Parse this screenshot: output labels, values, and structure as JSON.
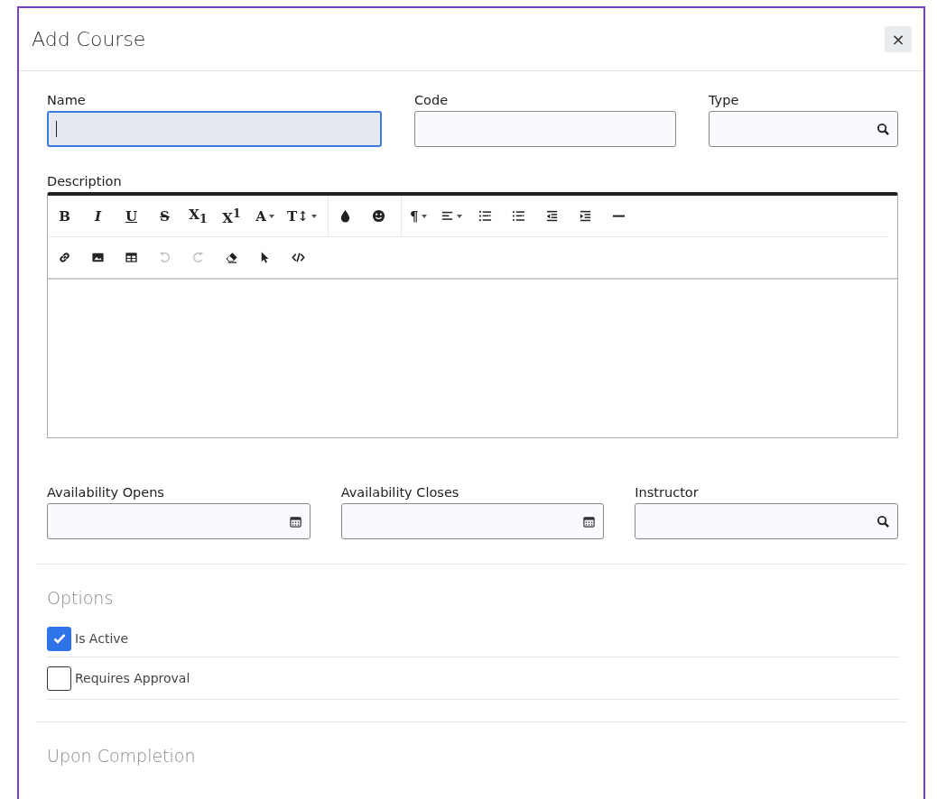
{
  "dialog": {
    "title": "Add Course",
    "close_label": "×"
  },
  "row_1": [
    {
      "label": "Name",
      "kind": "text",
      "focused": true
    },
    {
      "label": "Code",
      "kind": "text",
      "focused": false
    },
    {
      "label": "Type",
      "kind": "lookup",
      "focused": false
    }
  ],
  "description": {
    "label": "Description",
    "toolbar_rows": [
      [
        [
          {
            "kind": "bold",
            "glyph": "B",
            "disabled": false,
            "dropdown": false
          },
          {
            "kind": "italic",
            "glyph": "I",
            "disabled": false,
            "dropdown": false
          },
          {
            "kind": "underline",
            "glyph": "U",
            "disabled": false,
            "dropdown": false
          },
          {
            "kind": "strike",
            "glyph": "S",
            "disabled": false,
            "dropdown": false
          },
          {
            "kind": "script",
            "glyph": "X$_{1}$",
            "disabled": false,
            "dropdown": false
          },
          {
            "kind": "script",
            "glyph": "X$^{1}$",
            "disabled": false,
            "dropdown": false
          },
          {
            "kind": "letter",
            "glyph": "A",
            "disabled": false,
            "dropdown": true
          },
          {
            "kind": "letter",
            "glyph": "T↕",
            "disabled": false,
            "dropdown": true
          }
        ],
        [
          {
            "kind": "drop",
            "disabled": false,
            "dropdown": false
          },
          {
            "kind": "smiley",
            "disabled": false,
            "dropdown": false
          }
        ],
        [
          {
            "kind": "paragraph",
            "glyph": "¶",
            "disabled": false,
            "dropdown": true
          },
          {
            "kind": "align",
            "disabled": false,
            "dropdown": true
          },
          {
            "kind": "ordered-list",
            "disabled": false,
            "dropdown": false
          },
          {
            "kind": "bullet-list",
            "disabled": false,
            "dropdown": false
          },
          {
            "kind": "outdent",
            "disabled": false,
            "dropdown": false
          },
          {
            "kind": "indent",
            "disabled": false,
            "dropdown": false
          },
          {
            "kind": "rule",
            "disabled": false,
            "dropdown": false
          }
        ]
      ],
      [
        [
          {
            "kind": "link",
            "disabled": false,
            "dropdown": false
          },
          {
            "kind": "image",
            "disabled": false,
            "dropdown": false
          },
          {
            "kind": "table",
            "disabled": false,
            "dropdown": false
          },
          {
            "kind": "undo",
            "disabled": true,
            "dropdown": false
          },
          {
            "kind": "redo",
            "disabled": true,
            "dropdown": false
          },
          {
            "kind": "eraser",
            "disabled": false,
            "dropdown": false
          },
          {
            "kind": "pointer",
            "disabled": false,
            "dropdown": false
          },
          {
            "kind": "code",
            "disabled": false,
            "dropdown": false
          }
        ]
      ]
    ]
  },
  "row_2": [
    {
      "label": "Availability Opens",
      "kind": "date",
      "focused": false
    },
    {
      "label": "Availability Closes",
      "kind": "date",
      "focused": false
    },
    {
      "label": "Instructor",
      "kind": "lookup",
      "focused": false
    }
  ],
  "options": {
    "heading": "Options",
    "items": [
      {
        "label": "Is Active",
        "checked": true
      },
      {
        "label": "Requires Approval",
        "checked": false
      }
    ]
  },
  "upon_completion": {
    "heading": "Upon Completion"
  }
}
